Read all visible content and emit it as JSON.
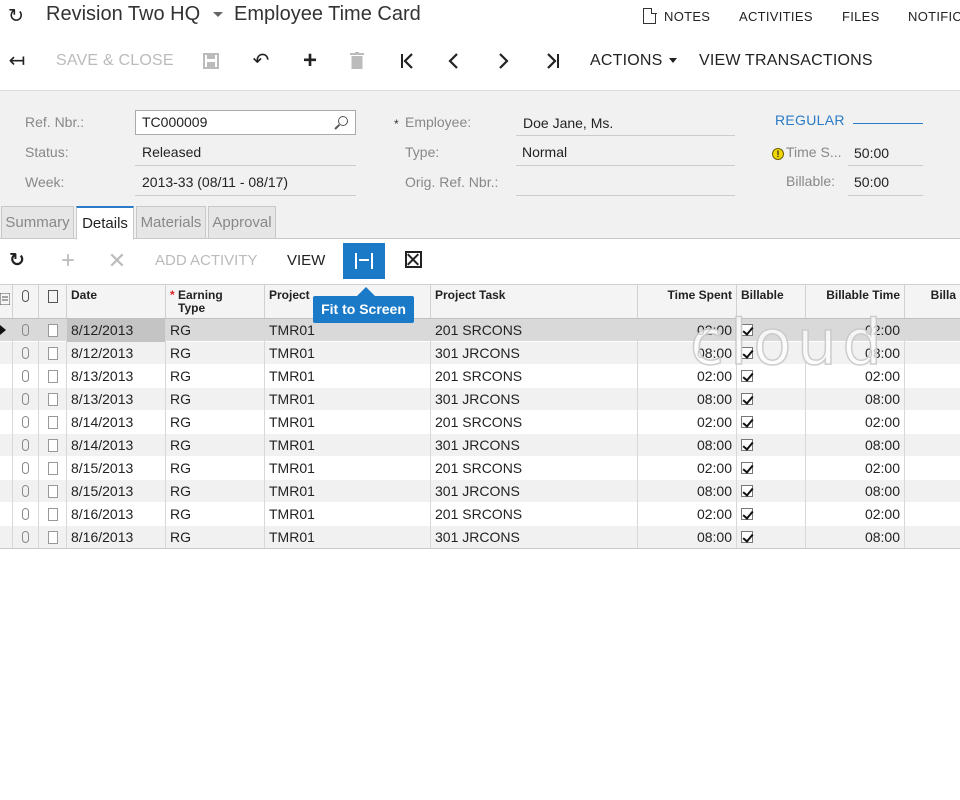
{
  "header": {
    "company": "Revision Two HQ",
    "screen_title": "Employee Time Card",
    "links": [
      "NOTES",
      "ACTIVITIES",
      "FILES",
      "NOTIFIC"
    ]
  },
  "toolbar": {
    "save_close": "SAVE & CLOSE",
    "actions": "ACTIONS",
    "view_transactions": "VIEW TRANSACTIONS"
  },
  "form": {
    "ref_nbr_label": "Ref. Nbr.:",
    "ref_nbr_value": "TC000009",
    "status_label": "Status:",
    "status_value": "Released",
    "week_label": "Week:",
    "week_value": "2013-33 (08/11 - 08/17)",
    "employee_label": "Employee:",
    "employee_value": "Doe Jane, Ms.",
    "type_label": "Type:",
    "type_value": "Normal",
    "orig_ref_label": "Orig. Ref. Nbr.:",
    "orig_ref_value": "",
    "regular_label": "REGULAR",
    "time_spent_label": "Time S...",
    "time_spent_value": "50:00",
    "billable_label": "Billable:",
    "billable_value": "50:00"
  },
  "tabs": [
    "Summary",
    "Details",
    "Materials",
    "Approval"
  ],
  "grid_toolbar": {
    "add_activity": "ADD ACTIVITY",
    "view": "VIEW",
    "tooltip": "Fit to Screen"
  },
  "grid": {
    "headers": {
      "date": "Date",
      "earning_type_1": "Earning",
      "earning_type_2": "Type",
      "project": "Project",
      "project_task": "Project Task",
      "time_spent": "Time Spent",
      "billable": "Billable",
      "billable_time": "Billable Time",
      "billable_ot": "Billa"
    },
    "rows": [
      {
        "date": "8/12/2013",
        "earning": "RG",
        "project": "TMR01",
        "task": "201 SRCONS",
        "time_spent": "02:00",
        "billable": true,
        "billable_time": "02:00"
      },
      {
        "date": "8/12/2013",
        "earning": "RG",
        "project": "TMR01",
        "task": "301 JRCONS",
        "time_spent": "08:00",
        "billable": true,
        "billable_time": "08:00"
      },
      {
        "date": "8/13/2013",
        "earning": "RG",
        "project": "TMR01",
        "task": "201 SRCONS",
        "time_spent": "02:00",
        "billable": true,
        "billable_time": "02:00"
      },
      {
        "date": "8/13/2013",
        "earning": "RG",
        "project": "TMR01",
        "task": "301 JRCONS",
        "time_spent": "08:00",
        "billable": true,
        "billable_time": "08:00"
      },
      {
        "date": "8/14/2013",
        "earning": "RG",
        "project": "TMR01",
        "task": "201 SRCONS",
        "time_spent": "02:00",
        "billable": true,
        "billable_time": "02:00"
      },
      {
        "date": "8/14/2013",
        "earning": "RG",
        "project": "TMR01",
        "task": "301 JRCONS",
        "time_spent": "08:00",
        "billable": true,
        "billable_time": "08:00"
      },
      {
        "date": "8/15/2013",
        "earning": "RG",
        "project": "TMR01",
        "task": "201 SRCONS",
        "time_spent": "02:00",
        "billable": true,
        "billable_time": "02:00"
      },
      {
        "date": "8/15/2013",
        "earning": "RG",
        "project": "TMR01",
        "task": "301 JRCONS",
        "time_spent": "08:00",
        "billable": true,
        "billable_time": "08:00"
      },
      {
        "date": "8/16/2013",
        "earning": "RG",
        "project": "TMR01",
        "task": "201 SRCONS",
        "time_spent": "02:00",
        "billable": true,
        "billable_time": "02:00"
      },
      {
        "date": "8/16/2013",
        "earning": "RG",
        "project": "TMR01",
        "task": "301 JRCONS",
        "time_spent": "08:00",
        "billable": true,
        "billable_time": "08:00"
      }
    ]
  },
  "watermark": "cloud",
  "colors": {
    "accent": "#1a7ac8",
    "link": "#2a7cc7",
    "panel": "#f1f1f1"
  }
}
